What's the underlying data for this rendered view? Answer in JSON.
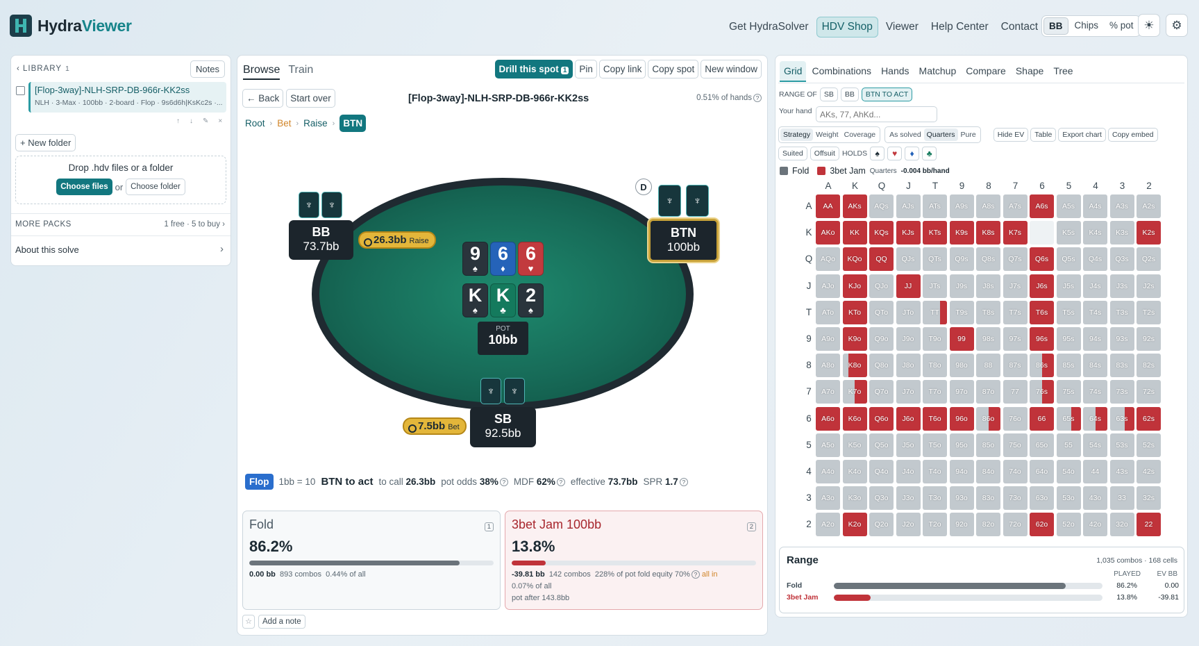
{
  "app": {
    "name_a": "Hydra",
    "name_b": "Viewer"
  },
  "nav": [
    "Get HydraSolver",
    "HDV Shop",
    "Viewer",
    "Help Center",
    "Contact"
  ],
  "units": [
    "BB",
    "Chips",
    "% pot"
  ],
  "icons": {
    "theme": "☀",
    "settings": "⚙"
  },
  "left": {
    "library_label": "LIBRARY",
    "library_count": "1",
    "notes": "Notes",
    "item_title": "[Flop-3way]-NLH-SRP-DB-966r-KK2ss",
    "item_sub": "NLH · 3-Max · 100bb · 2-board · Flop · 9s6d6h|KsKc2s ·...",
    "new_folder": "+ New folder",
    "drop_text": "Drop .hdv files or a folder",
    "choose_files": "Choose files",
    "or": "or",
    "choose_folder": "Choose folder",
    "more_packs": "MORE PACKS",
    "more_packs_info": "1 free · 5 to buy ›",
    "about": "About this solve",
    "about_chev": "›"
  },
  "mid": {
    "tabs": [
      "Browse",
      "Train"
    ],
    "drill": "Drill this spot",
    "drill_count": "1",
    "tools": [
      "Pin",
      "Copy link",
      "Copy spot",
      "New window"
    ],
    "back": "← Back",
    "start_over": "Start over",
    "spot": "[Flop-3way]-NLH-SRP-DB-966r-KK2ss",
    "pct_hands": "0.51% of hands",
    "crumbs": [
      "Root",
      "Bet",
      "Raise",
      "BTN"
    ],
    "seats": {
      "bb": {
        "name": "BB",
        "stack": "73.7bb"
      },
      "btn": {
        "name": "BTN",
        "stack": "100bb"
      },
      "sb": {
        "name": "SB",
        "stack": "92.5bb"
      }
    },
    "dealer": "D",
    "chips": {
      "bb": {
        "amt": "26.3bb",
        "lbl": "Raise"
      },
      "sb": {
        "amt": "7.5bb",
        "lbl": "Bet"
      }
    },
    "board": [
      {
        "rank": "9",
        "suit": "♠",
        "color": "spade"
      },
      {
        "rank": "6",
        "suit": "♦",
        "color": "diam"
      },
      {
        "rank": "6",
        "suit": "♥",
        "color": "heart"
      },
      {
        "rank": "K",
        "suit": "♠",
        "color": "spade"
      },
      {
        "rank": "K",
        "suit": "♣",
        "color": "club"
      },
      {
        "rank": "2",
        "suit": "♠",
        "color": "spade"
      }
    ],
    "pot_label": "POT",
    "pot_value": "10bb",
    "info": {
      "street": "Flop",
      "bbchips": "1bb = 10",
      "actor": "BTN to act",
      "to_call_l": "to call",
      "to_call": "26.3bb",
      "pot_odds_l": "pot odds",
      "pot_odds": "38%",
      "mdf_l": "MDF",
      "mdf": "62%",
      "eff_l": "effective",
      "eff": "73.7bb",
      "spr_l": "SPR",
      "spr": "1.7"
    },
    "actions": [
      {
        "name": "Fold",
        "pct": "86.2%",
        "freq": 0.862,
        "num": "1",
        "ev": "0.00 bb",
        "combos": "893 combos",
        "extra": "0.44% of all",
        "line2": "",
        "line3": ""
      },
      {
        "name": "3bet Jam 100bb",
        "pct": "13.8%",
        "freq": 0.138,
        "num": "2",
        "ev": "-39.81 bb",
        "combos": "142 combos",
        "extra": "228% of pot  fold equity 70%",
        "allin": "all in",
        "line2": "0.07% of all",
        "line3": "pot after 143.8bb"
      }
    ],
    "star": "☆",
    "add_note": "Add a note"
  },
  "right": {
    "tabs": [
      "Grid",
      "Combinations",
      "Hands",
      "Matchup",
      "Compare",
      "Shape",
      "Tree"
    ],
    "range_of": "RANGE OF",
    "range_btns": [
      "SB",
      "BB",
      "BTN TO ACT"
    ],
    "your_hand": "Your hand",
    "hand_placeholder": "AKs, 77, AhKd...",
    "seg1": [
      "Strategy",
      "Weight",
      "Coverage"
    ],
    "seg2": [
      "As solved",
      "Quarters",
      "Pure"
    ],
    "seg3": [
      "Hide EV",
      "Table",
      "Export chart",
      "Copy embed"
    ],
    "filt": [
      "Suited",
      "Offsuit"
    ],
    "holds": "HOLDS",
    "legend": {
      "fold": "Fold",
      "jam": "3bet Jam",
      "quarters": "Quarters",
      "ev": "-0.004 bb/hand"
    },
    "colors": {
      "fold": "#6b747b",
      "jam": "#c0333a"
    },
    "ranks": [
      "A",
      "K",
      "Q",
      "J",
      "T",
      "9",
      "8",
      "7",
      "6",
      "5",
      "4",
      "3",
      "2"
    ],
    "jam_freq": [
      [
        1,
        1,
        0,
        0,
        0,
        0,
        0,
        0,
        1,
        0,
        0,
        0,
        0
      ],
      [
        1,
        1,
        1,
        1,
        1,
        1,
        1,
        1,
        -1,
        0,
        0,
        0,
        1
      ],
      [
        0,
        1,
        1,
        0,
        0,
        0,
        0,
        0,
        1,
        0,
        0,
        0,
        0
      ],
      [
        0,
        1,
        0,
        1,
        0,
        0,
        0,
        0,
        1,
        0,
        0,
        0,
        0
      ],
      [
        0,
        1,
        0,
        0,
        0.3,
        0,
        0,
        0,
        1,
        0,
        0,
        0,
        0
      ],
      [
        0,
        1,
        0,
        0,
        0,
        1,
        0,
        0,
        1,
        0,
        0,
        0,
        0
      ],
      [
        0,
        0.75,
        0,
        0,
        0,
        0,
        0,
        0,
        0.5,
        0,
        0,
        0,
        0
      ],
      [
        0,
        0.5,
        0,
        0,
        0,
        0,
        0,
        0,
        0.5,
        0,
        0,
        0,
        0
      ],
      [
        1,
        1,
        1,
        1,
        1,
        1,
        0.5,
        0,
        1,
        0.4,
        0.5,
        0.4,
        1
      ],
      [
        0,
        0,
        0,
        0,
        0,
        0,
        0,
        0,
        0,
        0,
        0,
        0,
        0
      ],
      [
        0,
        0,
        0,
        0,
        0,
        0,
        0,
        0,
        0,
        0,
        0,
        0,
        0
      ],
      [
        0,
        0,
        0,
        0,
        0,
        0,
        0,
        0,
        0,
        0,
        0,
        0,
        0
      ],
      [
        0,
        1,
        0,
        0,
        0,
        0,
        0,
        0,
        1,
        0,
        0,
        0,
        1
      ]
    ],
    "range_title": "Range",
    "range_count": "1,035 combos · 168 cells",
    "played": "PLAYED",
    "evbb": "EV BB",
    "range_rows": [
      {
        "name": "Fold",
        "played": "86.2%",
        "ev": "0.00",
        "frac": 0.862
      },
      {
        "name": "3bet Jam",
        "played": "13.8%",
        "ev": "-39.81",
        "frac": 0.138
      }
    ]
  }
}
